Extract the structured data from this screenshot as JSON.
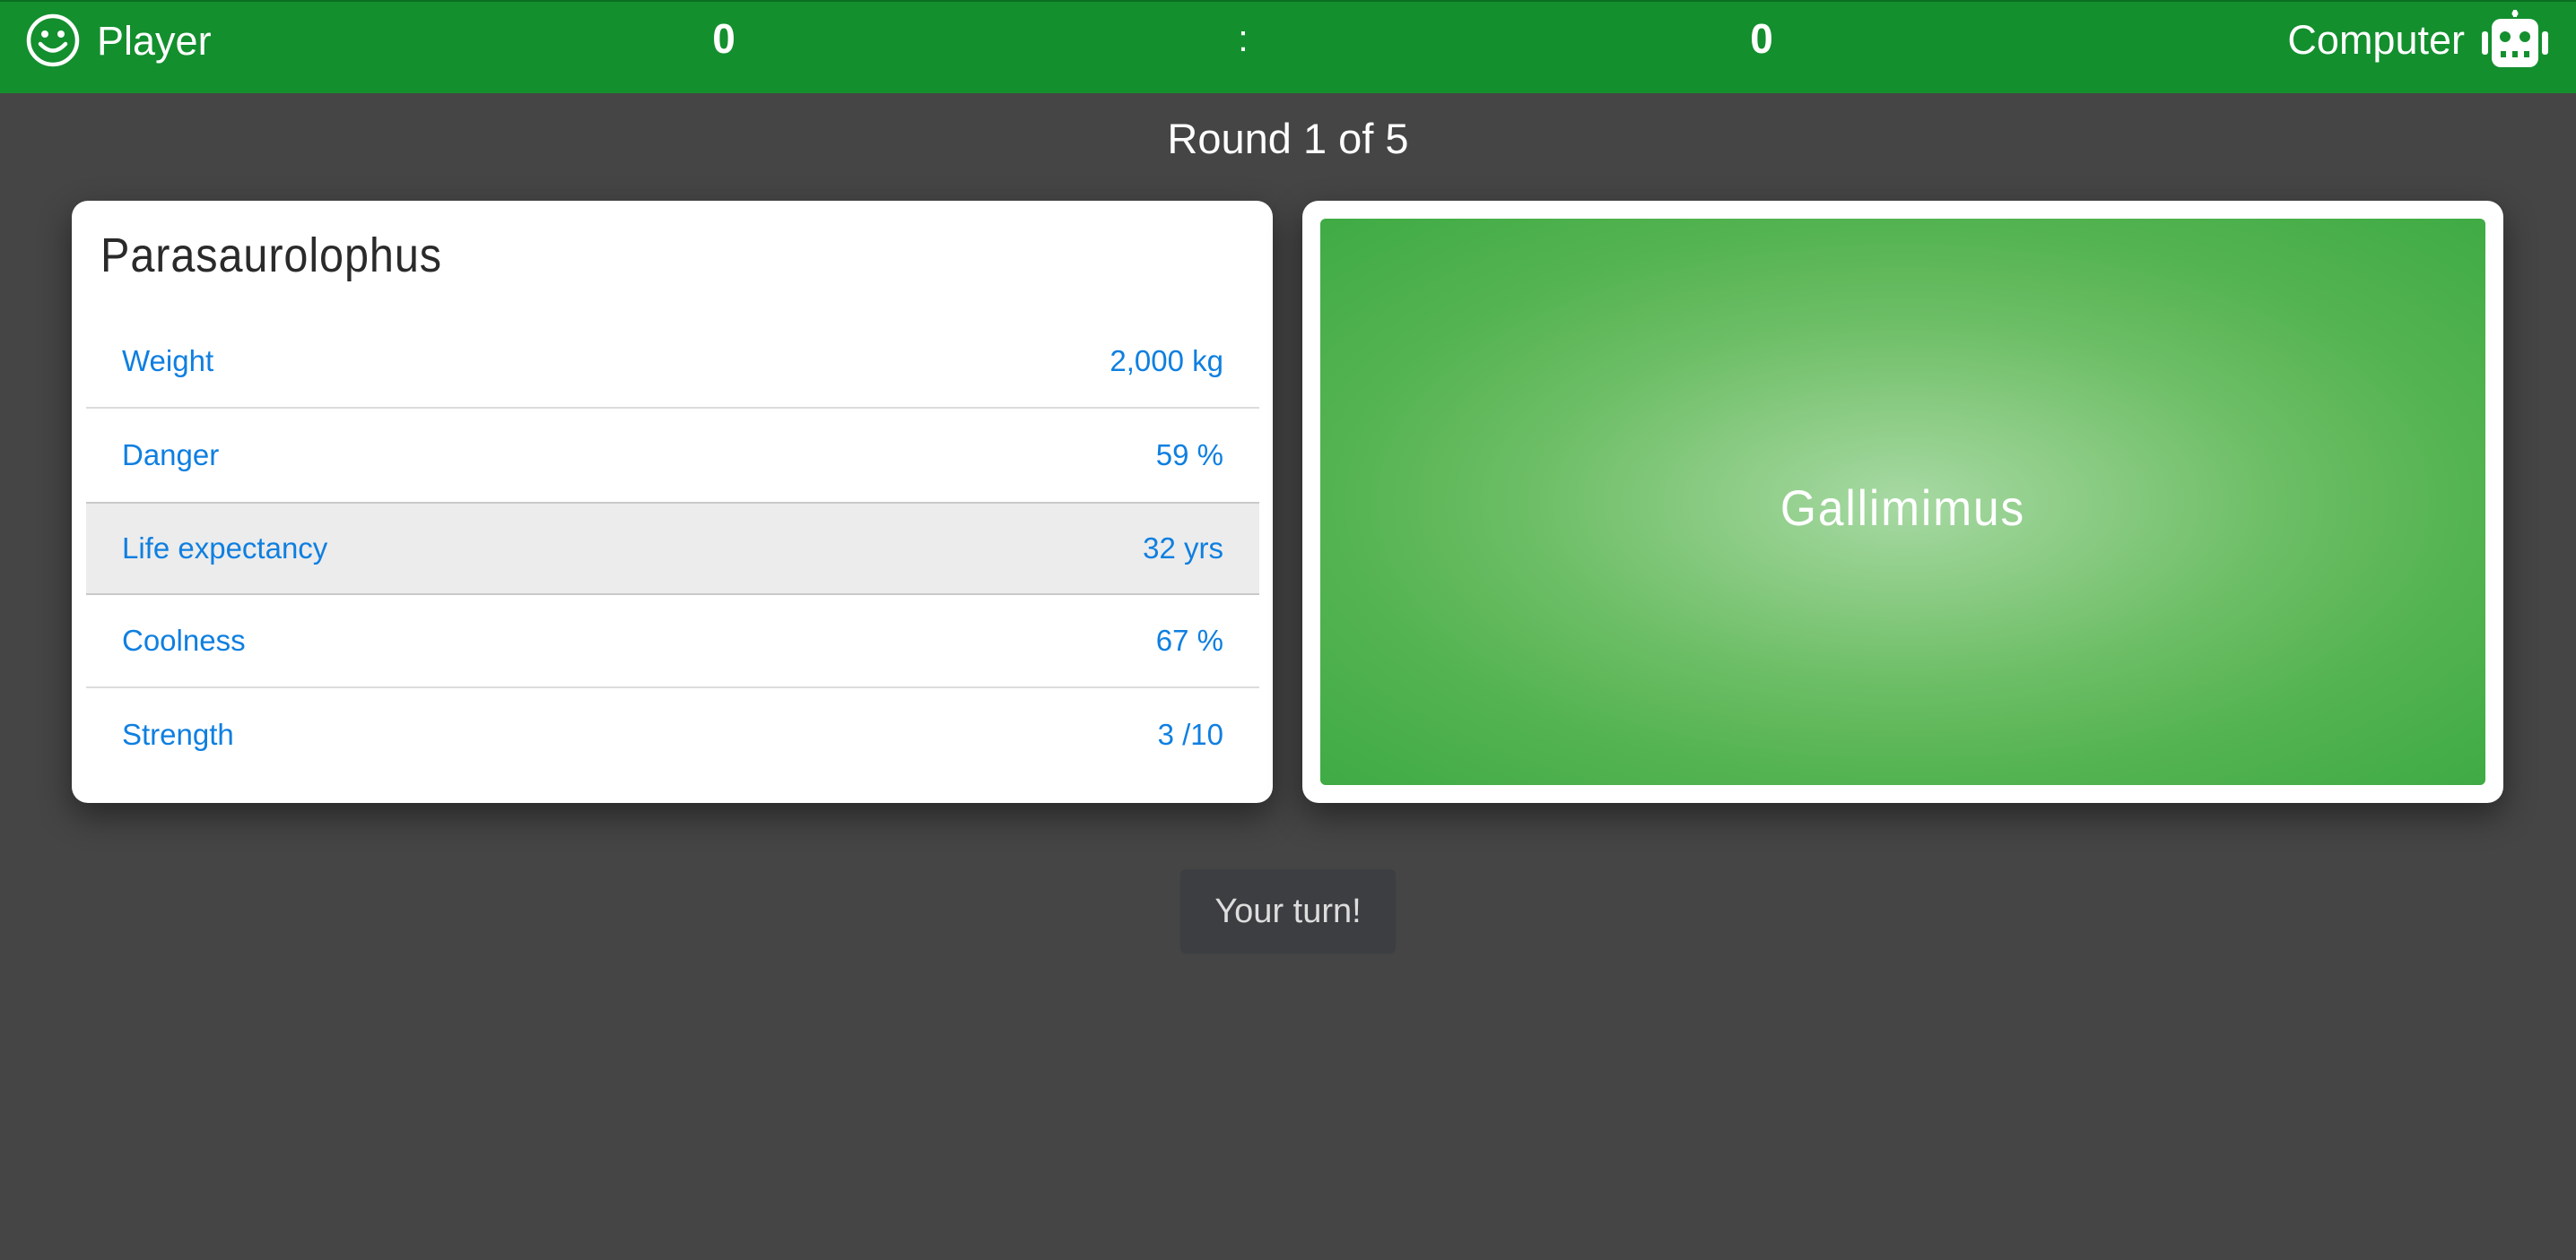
{
  "scoreboard": {
    "player_label": "Player",
    "player_icon": "smiley-icon",
    "player_score": "0",
    "separator": ":",
    "computer_score": "0",
    "computer_label": "Computer",
    "computer_icon": "robot-icon",
    "bar_color": "#138f2e"
  },
  "round": {
    "text": "Round 1 of 5"
  },
  "player_card": {
    "name": "Parasaurolophus",
    "stats": [
      {
        "label": "Weight",
        "value": "2,000 kg",
        "selected": false
      },
      {
        "label": "Danger",
        "value": "59 %",
        "selected": false
      },
      {
        "label": "Life expectancy",
        "value": "32 yrs",
        "selected": true
      },
      {
        "label": "Coolness",
        "value": "67 %",
        "selected": false
      },
      {
        "label": "Strength",
        "value": "3 /10",
        "selected": false
      }
    ],
    "stat_color": "#0f7fe0"
  },
  "computer_card": {
    "name": "Gallimimus",
    "back_color": "#3fab44"
  },
  "status": {
    "text": "Your turn!"
  }
}
